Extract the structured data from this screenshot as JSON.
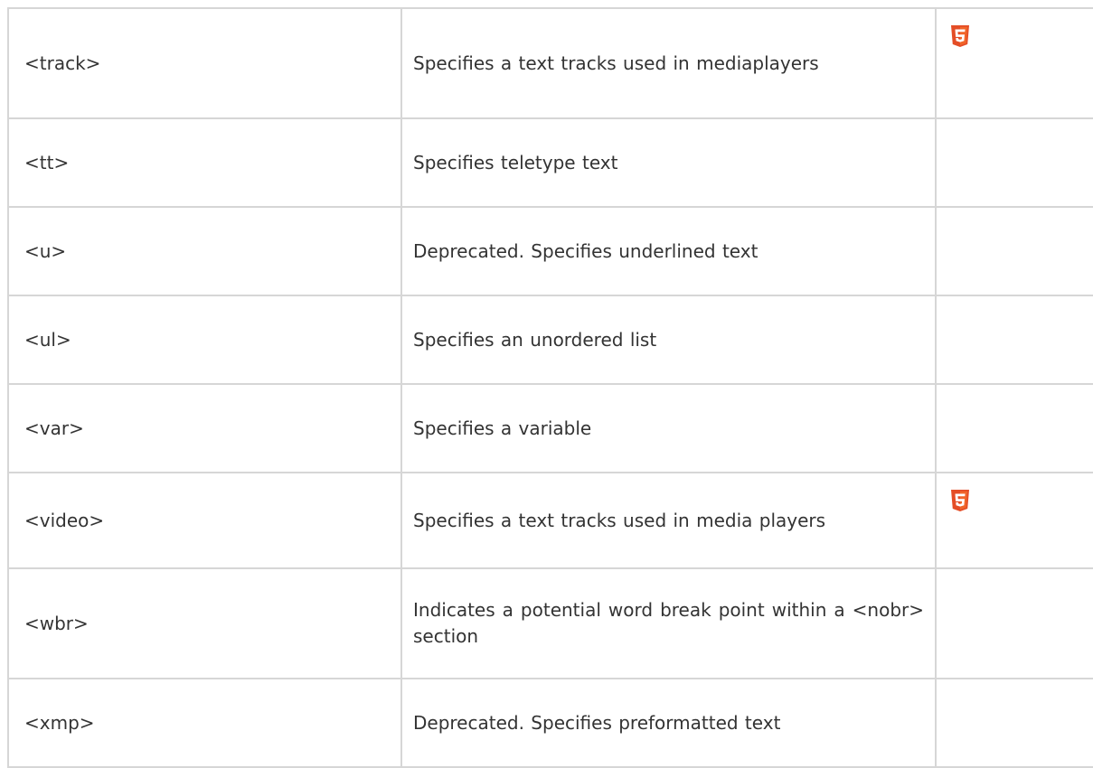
{
  "rows": [
    {
      "tag": "<track>",
      "description": "Specifies a text tracks used in mediaplayers",
      "html5": true
    },
    {
      "tag": "<tt>",
      "description": "Specifies teletype text",
      "html5": false
    },
    {
      "tag": "<u>",
      "description": "Deprecated. Specifies underlined text",
      "html5": false
    },
    {
      "tag": "<ul>",
      "description": "Specifies an unordered list",
      "html5": false
    },
    {
      "tag": "<var>",
      "description": "Specifies a variable",
      "html5": false
    },
    {
      "tag": "<video>",
      "description": "Specifies a text tracks used in media players",
      "html5": true
    },
    {
      "tag": "<wbr>",
      "description": "Indicates a potential word break point within a <nobr> section",
      "html5": false
    },
    {
      "tag": "<xmp>",
      "description": "Deprecated. Specifies preformatted text",
      "html5": false
    }
  ],
  "colors": {
    "border": "#d6d6d6",
    "text": "#333333",
    "html5_icon": "#e44d26"
  },
  "icons": {
    "html5": "html5-icon"
  }
}
